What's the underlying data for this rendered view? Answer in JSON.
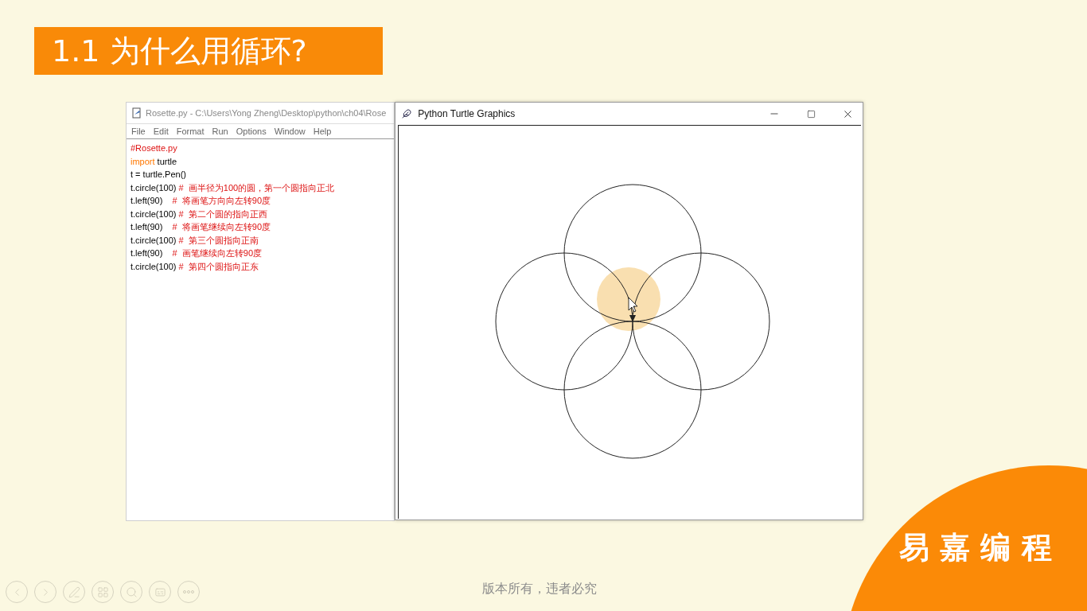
{
  "slide_title": "1.1 为什么用循环?",
  "editor": {
    "title": "Rosette.py - C:\\Users\\Yong Zheng\\Desktop\\python\\ch04\\Rose",
    "menu": [
      "File",
      "Edit",
      "Format",
      "Run",
      "Options",
      "Window",
      "Help"
    ],
    "lines": [
      [
        {
          "kind": "comment",
          "text": "#Rosette.py"
        }
      ],
      [
        {
          "kind": "keyword",
          "text": "import"
        },
        {
          "kind": "code",
          "text": " turtle"
        }
      ],
      [
        {
          "kind": "code",
          "text": "t = turtle.Pen()"
        }
      ],
      [
        {
          "kind": "code",
          "text": "t.circle(100) "
        },
        {
          "kind": "comment",
          "text": "#  画半径为100的圆，第一个圆指向正北"
        }
      ],
      [
        {
          "kind": "code",
          "text": "t.left(90)    "
        },
        {
          "kind": "comment",
          "text": "#  将画笔方向向左转90度"
        }
      ],
      [
        {
          "kind": "code",
          "text": "t.circle(100) "
        },
        {
          "kind": "comment",
          "text": "#  第二个圆的指向正西"
        }
      ],
      [
        {
          "kind": "code",
          "text": "t.left(90)    "
        },
        {
          "kind": "comment",
          "text": "#  将画笔继续向左转90度"
        }
      ],
      [
        {
          "kind": "code",
          "text": "t.circle(100) "
        },
        {
          "kind": "comment",
          "text": "#  第三个圆指向正南"
        }
      ],
      [
        {
          "kind": "code",
          "text": "t.left(90)    "
        },
        {
          "kind": "comment",
          "text": "#  画笔继续向左转90度"
        }
      ],
      [
        {
          "kind": "code",
          "text": "t.circle(100) "
        },
        {
          "kind": "comment",
          "text": "#  第四个圆指向正东"
        }
      ]
    ]
  },
  "turtle_window": {
    "title": "Python Turtle Graphics"
  },
  "brand": "易 嘉 编 程",
  "copyright": "版本所有，违者必究"
}
